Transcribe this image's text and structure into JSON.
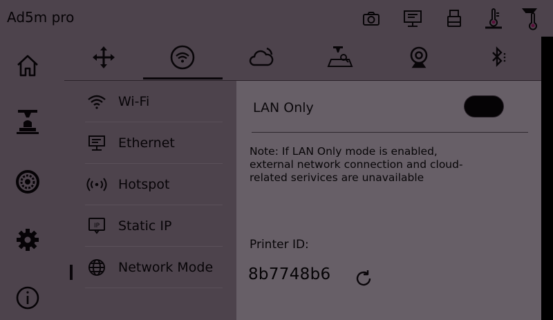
{
  "app": {
    "title": "Ad5m pro"
  },
  "topbar": {
    "icons": [
      "camera-icon",
      "monitor-network-icon",
      "usb-drive-icon",
      "nozzle-temperature-icon",
      "bed-temperature-icon"
    ]
  },
  "sidebar": {
    "items": [
      {
        "icon": "home-icon"
      },
      {
        "icon": "print-job-icon"
      },
      {
        "icon": "filament-spool-icon"
      },
      {
        "icon": "gear-icon"
      },
      {
        "icon": "info-icon"
      }
    ]
  },
  "tabs": {
    "items": [
      {
        "icon": "move-axes-icon"
      },
      {
        "icon": "wifi-icon",
        "active": true
      },
      {
        "icon": "cloud-icon"
      },
      {
        "icon": "printer-calibrate-icon"
      },
      {
        "icon": "webcam-icon"
      },
      {
        "icon": "bluetooth-icon"
      }
    ]
  },
  "network_menu": {
    "items": [
      {
        "label": "Wi-Fi",
        "icon": "wifi-icon"
      },
      {
        "label": "Ethernet",
        "icon": "ethernet-icon"
      },
      {
        "label": "Hotspot",
        "icon": "hotspot-icon"
      },
      {
        "label": "Static IP",
        "icon": "ip-icon"
      },
      {
        "label": "Network Mode",
        "icon": "globe-icon",
        "active": true
      }
    ]
  },
  "network_mode": {
    "lan_only_label": "LAN Only",
    "lan_only_enabled": false,
    "note": "Note: If LAN Only mode is enabled, external network connection and cloud-related serivices are unavailable",
    "printer_id_label": "Printer ID:",
    "printer_id": "8b7748b6"
  },
  "colors": {
    "panel": "#4d434c",
    "content": "#675f67",
    "text": "#070507"
  }
}
